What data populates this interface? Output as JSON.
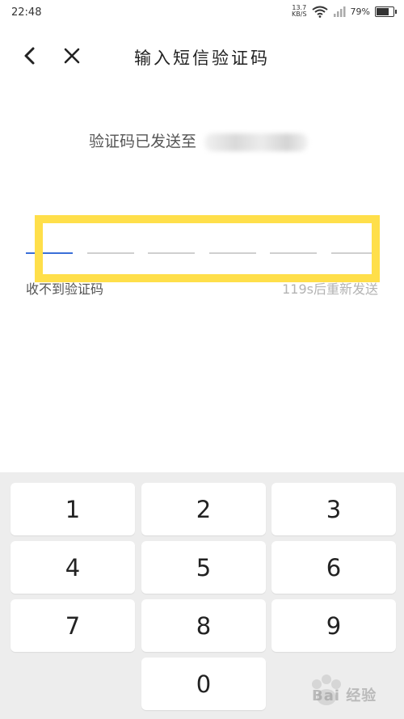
{
  "status_bar": {
    "time": "22:48",
    "net_speed_value": "13.7",
    "net_speed_unit": "KB/S",
    "battery_percent": "79%",
    "battery_level": 0.79
  },
  "nav": {
    "title": "输入短信验证码"
  },
  "verification": {
    "sent_to_label": "验证码已发送至",
    "code_length": 6,
    "active_slot_index": 0
  },
  "links": {
    "no_code": "收不到验证码",
    "resend_countdown": "119s后重新发送"
  },
  "keypad": {
    "keys": [
      "1",
      "2",
      "3",
      "4",
      "5",
      "6",
      "7",
      "8",
      "9",
      "0"
    ]
  },
  "watermark": {
    "text": "Bai 经验"
  },
  "colors": {
    "highlight": "#ffdf4a",
    "active_underline": "#3a6fd8",
    "keypad_background": "#ededed"
  }
}
